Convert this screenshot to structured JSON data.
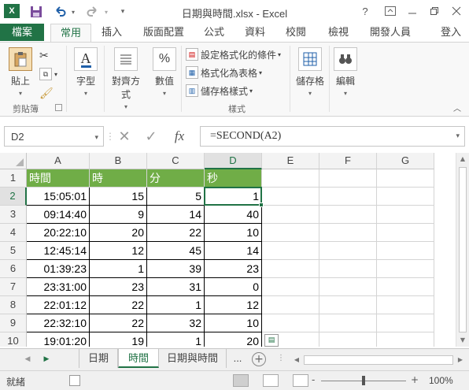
{
  "window": {
    "title": "日期與時間.xlsx - Excel",
    "help_label": "?",
    "app_icon_label": "X",
    "colors": {
      "accent": "#217346",
      "header_fill": "#70ad47"
    }
  },
  "ribbon_tabs": {
    "file": "檔案",
    "home": "常用",
    "insert": "插入",
    "page_layout": "版面配置",
    "formulas": "公式",
    "data": "資料",
    "review": "校閱",
    "view": "檢視",
    "developer": "開發人員",
    "signin": "登入"
  },
  "ribbon": {
    "paste": "貼上",
    "clipboard_group": "剪貼簿",
    "font": "字型",
    "alignment": "對齊方式",
    "number": "數值",
    "number_glyph": "%",
    "conditional_formatting": "設定格式化的條件",
    "format_as_table": "格式化為表格",
    "cell_styles": "儲存格樣式",
    "styles_group": "樣式",
    "cells": "儲存格",
    "editing": "編輯"
  },
  "formula_bar": {
    "name_box": "D2",
    "formula": "=SECOND(A2)",
    "fx": "fx"
  },
  "grid": {
    "columns": [
      "A",
      "B",
      "C",
      "D",
      "E",
      "F",
      "G"
    ],
    "rows": [
      "1",
      "2",
      "3",
      "4",
      "5",
      "6",
      "7",
      "8",
      "9",
      "10"
    ],
    "header_row": [
      "時間",
      "時",
      "分",
      "秒"
    ],
    "data": [
      [
        "15:05:01",
        "15",
        "5",
        "1"
      ],
      [
        "09:14:40",
        "9",
        "14",
        "40"
      ],
      [
        "20:22:10",
        "20",
        "22",
        "10"
      ],
      [
        "12:45:14",
        "12",
        "45",
        "14"
      ],
      [
        "01:39:23",
        "1",
        "39",
        "23"
      ],
      [
        "23:31:00",
        "23",
        "31",
        "0"
      ],
      [
        "22:01:12",
        "22",
        "1",
        "12"
      ],
      [
        "22:32:10",
        "22",
        "32",
        "10"
      ],
      [
        "19:01:20",
        "19",
        "1",
        "20"
      ]
    ],
    "active_cell": "D2"
  },
  "sheets": {
    "tabs": [
      "日期",
      "時間",
      "日期與時間"
    ],
    "active": "時間",
    "more": "..."
  },
  "status_bar": {
    "mode": "就緒",
    "zoom": "100%",
    "zoom_minus": "-",
    "zoom_plus": "+"
  }
}
